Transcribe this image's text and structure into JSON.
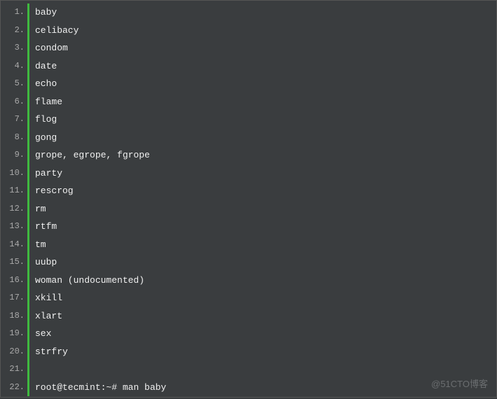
{
  "lines": [
    {
      "n": "1.",
      "text": "baby"
    },
    {
      "n": "2.",
      "text": "celibacy"
    },
    {
      "n": "3.",
      "text": "condom"
    },
    {
      "n": "4.",
      "text": "date"
    },
    {
      "n": "5.",
      "text": "echo"
    },
    {
      "n": "6.",
      "text": "flame"
    },
    {
      "n": "7.",
      "text": "flog"
    },
    {
      "n": "8.",
      "text": "gong"
    },
    {
      "n": "9.",
      "text": "grope, egrope, fgrope"
    },
    {
      "n": "10.",
      "text": "party"
    },
    {
      "n": "11.",
      "text": "rescrog"
    },
    {
      "n": "12.",
      "text": "rm"
    },
    {
      "n": "13.",
      "text": "rtfm"
    },
    {
      "n": "14.",
      "text": "tm"
    },
    {
      "n": "15.",
      "text": "uubp"
    },
    {
      "n": "16.",
      "text": "woman (undocumented)"
    },
    {
      "n": "17.",
      "text": "xkill"
    },
    {
      "n": "18.",
      "text": "xlart"
    },
    {
      "n": "19.",
      "text": "sex"
    },
    {
      "n": "20.",
      "text": "strfry"
    },
    {
      "n": "21.",
      "text": ""
    },
    {
      "n": "22.",
      "text": "root@tecmint:~# man baby"
    }
  ],
  "watermark": "@51CTO博客"
}
